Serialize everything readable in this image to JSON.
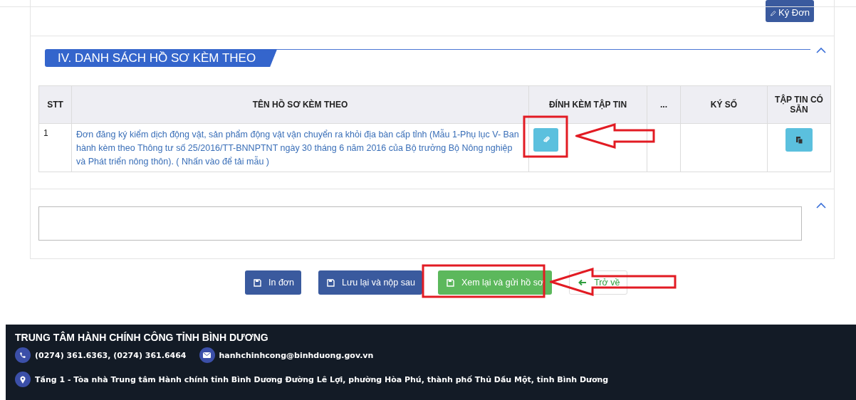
{
  "sign_button": {
    "label": "Ký Đơn"
  },
  "section": {
    "title": "IV. DANH SÁCH HỒ SƠ KÈM THEO",
    "expanded": true
  },
  "table": {
    "columns": [
      "STT",
      "TÊN HỒ SƠ KÈM THEO",
      "ĐÍNH KÈM TẬP TIN",
      "...",
      "KÝ SỐ",
      "TẬP TIN CÓ SẴN"
    ],
    "rows": [
      {
        "stt": "1",
        "name": "Đơn đăng ký kiểm dịch động vật, sản phẩm động vật vận chuyển ra khỏi địa bàn cấp tỉnh (Mẫu 1-Phụ lục V- Ban hành kèm theo Thông tư số 25/2016/TT-BNNPTNT ngày 30 tháng 6 năm 2016 của Bộ trưởng Bộ Nông nghiệp và Phát triển nông thôn). ( Nhấn vào để tải mẫu )"
      }
    ]
  },
  "note_panel": {
    "expanded": true
  },
  "actions": [
    {
      "label": "In đơn",
      "kind": "primary"
    },
    {
      "label": "Lưu lại và nộp sau",
      "kind": "primary"
    },
    {
      "label": "Xem lại và gửi hồ sơ",
      "kind": "success"
    },
    {
      "label": "Trở về",
      "kind": "back"
    }
  ],
  "footer": {
    "title": "TRUNG TÂM HÀNH CHÍNH CÔNG TỈNH BÌNH DƯƠNG",
    "phone": "(0274) 361.6363, (0274) 361.6464",
    "email": "hanhchinhcong@binhduong.gov.vn",
    "address": "Tầng 1 - Tòa nhà Trung tâm Hành chính tỉnh Bình Dương Đường Lê Lợi, phường Hòa Phú, thành phố Thủ Dầu Một, tỉnh Bình Dương"
  }
}
